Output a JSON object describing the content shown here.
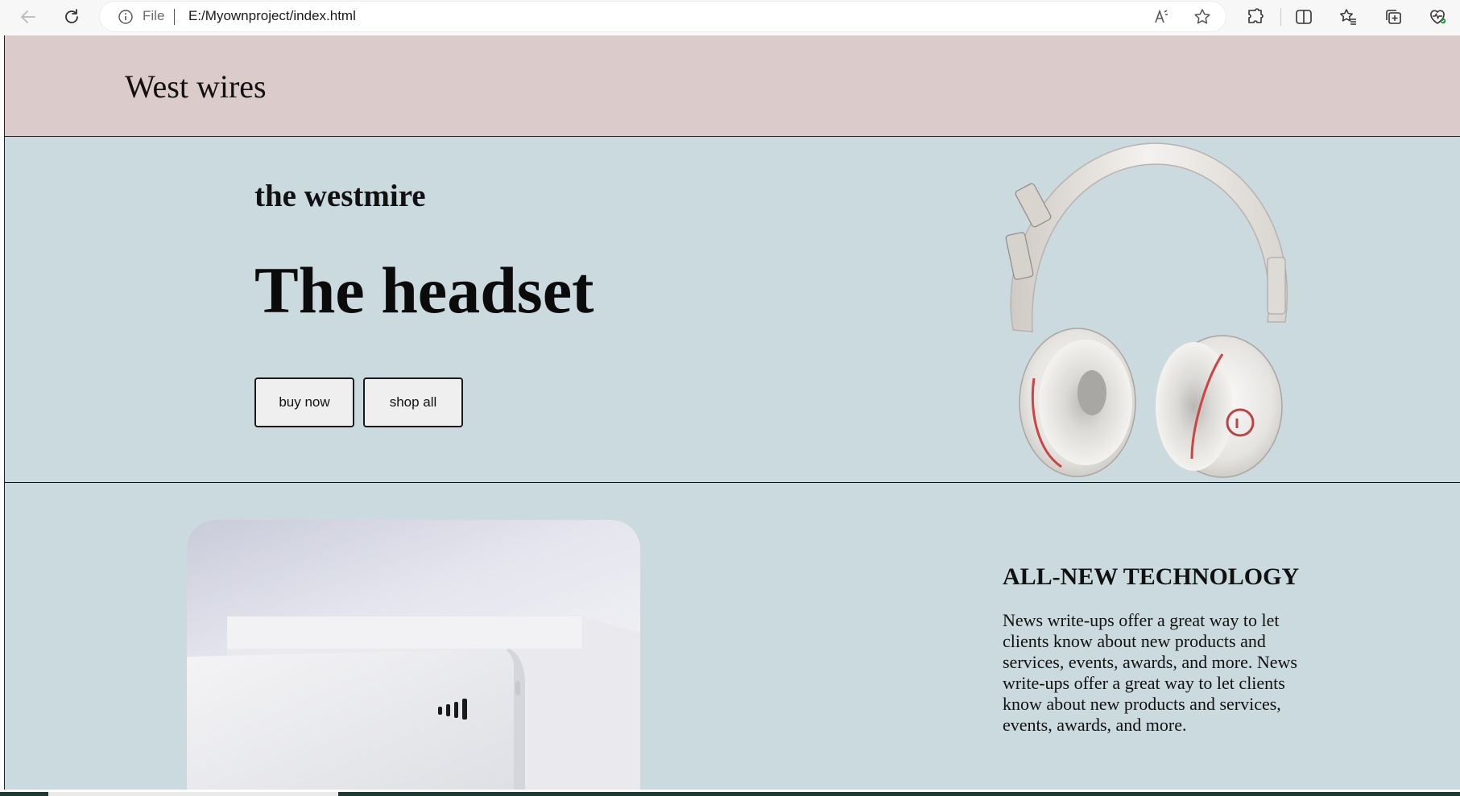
{
  "browser": {
    "address_scheme": "File",
    "address_url": "E:/Myownproject/index.html",
    "icons": [
      "back-arrow-icon",
      "refresh-icon",
      "info-icon",
      "read-aloud-icon",
      "favorite-star-icon",
      "extensions-icon",
      "split-screen-icon",
      "favorites-icon",
      "collections-icon",
      "browser-essentials-icon"
    ]
  },
  "header": {
    "logo_text": "West wires"
  },
  "hero": {
    "subtitle": "the westmire",
    "title": "The headset",
    "buy_label": "buy now",
    "shop_label": "shop all",
    "image": "white-headphones-photo"
  },
  "feature": {
    "image": "white-power-bank-photo",
    "title": "ALL-NEW TECHNOLOGY",
    "text": "News write-ups offer a great way to let clients know about new products and services, events, awards, and more. News write-ups offer a great way to let clients know about new products and services, events, awards, and more."
  },
  "colors": {
    "header_bg": "#dccbcb",
    "hero_bg": "#cbdade",
    "button_bg": "#efefef"
  }
}
